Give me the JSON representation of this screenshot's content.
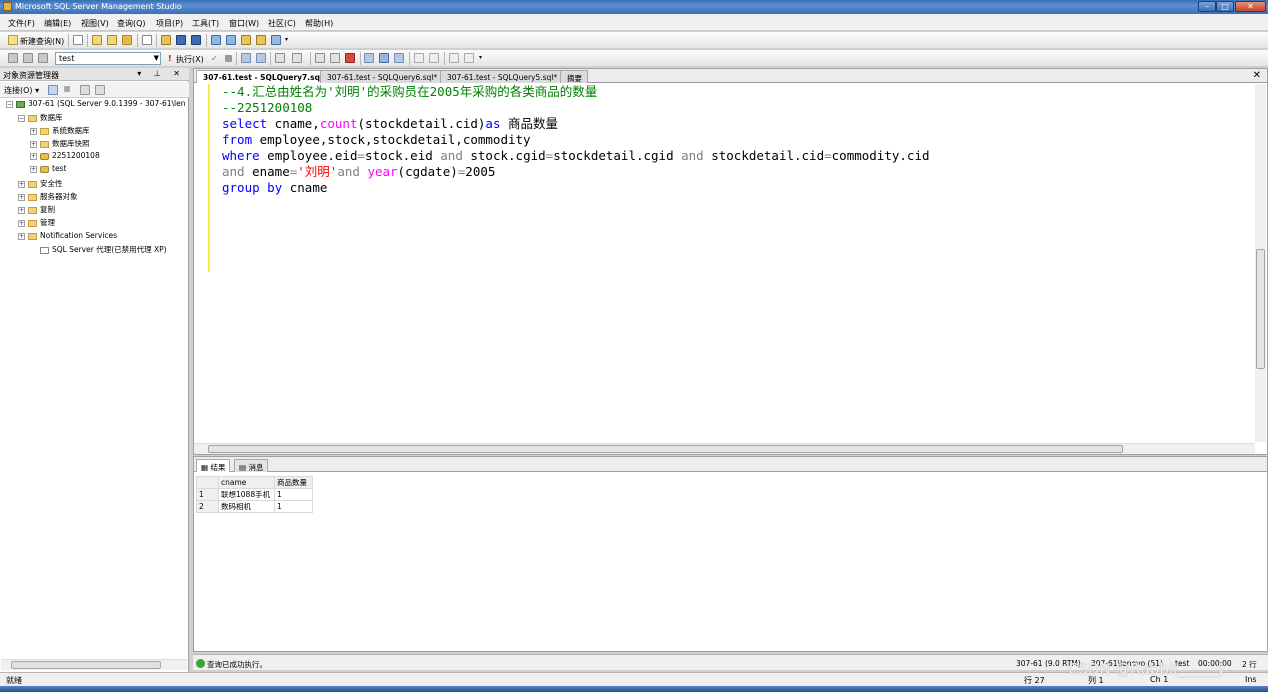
{
  "window": {
    "title": "Microsoft SQL Server Management Studio"
  },
  "menu": [
    "文件(F)",
    "编辑(E)",
    "视图(V)",
    "查询(Q)",
    "项目(P)",
    "工具(T)",
    "窗口(W)",
    "社区(C)",
    "帮助(H)"
  ],
  "toolbar": {
    "new_query_label": "新建查询(N)",
    "database_selected": "test",
    "execute_label": "执行(X)"
  },
  "object_explorer": {
    "title": "对象资源管理器",
    "connect_label": "连接(O) ▾",
    "tree": [
      {
        "label": "307-61 (SQL Server 9.0.1399 - 307-61\\len",
        "exp": "−",
        "icon": "srv"
      },
      {
        "label": "数据库",
        "exp": "−",
        "icon": "folder"
      },
      {
        "label": "系统数据库",
        "exp": "+",
        "icon": "folder"
      },
      {
        "label": "数据库快照",
        "exp": "+",
        "icon": "folder"
      },
      {
        "label": "2251200108",
        "exp": "+",
        "icon": "db"
      },
      {
        "label": "test",
        "exp": "+",
        "icon": "db"
      },
      {
        "label": "安全性",
        "exp": "+",
        "icon": "folder"
      },
      {
        "label": "服务器对象",
        "exp": "+",
        "icon": "folder"
      },
      {
        "label": "复制",
        "exp": "+",
        "icon": "folder"
      },
      {
        "label": "管理",
        "exp": "+",
        "icon": "folder"
      },
      {
        "label": "Notification Services",
        "exp": "+",
        "icon": "folder"
      },
      {
        "label": "SQL Server 代理(已禁用代理 XP)",
        "exp": "",
        "icon": "agent"
      }
    ]
  },
  "editor": {
    "tabs": [
      "307-61.test - SQLQuery7.sql*",
      "307-61.test - SQLQuery6.sql*",
      "307-61.test - SQLQuery5.sql*",
      "摘要"
    ],
    "active_tab": 0,
    "code": {
      "l1": "--4.汇总由姓名为'刘明'的采购员在2005年采购的各类商品的数量",
      "l2": "--2251200108",
      "l3a": "select",
      "l3b": " cname,",
      "l3c": "count",
      "l3d": "(stockdetail.cid)",
      "l3e": "as",
      "l3f": " 商品数量",
      "l4a": "from",
      "l4b": " employee,stock,stockdetail,commodity",
      "l5a": "where",
      "l5b": " employee.eid",
      "l5c": "=",
      "l5d": "stock.eid ",
      "l5e": "and",
      "l5f": " stock.cgid",
      "l5g": "=",
      "l5h": "stockdetail.cgid ",
      "l5i": "and",
      "l5j": " stockdetail.cid",
      "l5k": "=",
      "l5l": "commodity.cid",
      "l6a": "and",
      "l6b": " ename",
      "l6c": "=",
      "l6d": "'刘明'",
      "l6e": "and",
      "l6f": " ",
      "l6g": "year",
      "l6h": "(cgdate)",
      "l6i": "=",
      "l6j": "2005",
      "l7a": "group",
      "l7b": " ",
      "l7c": "by",
      "l7d": " cname"
    }
  },
  "results": {
    "tabs": [
      "结果",
      "消息"
    ],
    "columns": [
      "cname",
      "商品数量"
    ],
    "rows": [
      {
        "n": "1",
        "cname": "联想1088手机",
        "qty": "1"
      },
      {
        "n": "2",
        "cname": "数码相机",
        "qty": "1"
      }
    ]
  },
  "query_status": {
    "message": "查询已成功执行。",
    "server": "307-61 (9.0 RTM)",
    "login": "307-61\\lenovo (51)",
    "database": "test",
    "elapsed": "00:00:00",
    "rows": "2 行"
  },
  "app_status": {
    "ready": "就绪",
    "line": "行 27",
    "col": "列 1",
    "ch": "Ch 1",
    "ins": "Ins"
  },
  "watermark": "CSDN @Rabbit_____y"
}
